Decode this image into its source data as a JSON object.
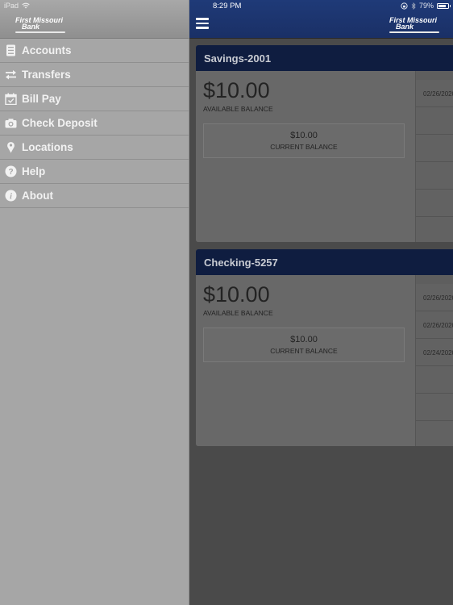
{
  "status_bar": {
    "device": "iPad",
    "time": "8:29 PM",
    "battery": "79%",
    "battery_level": 0.79
  },
  "brand": {
    "line1": "First Missouri",
    "line2": "Bank"
  },
  "sidebar": {
    "items": [
      {
        "label": "Accounts",
        "icon": "accounts-icon"
      },
      {
        "label": "Transfers",
        "icon": "transfers-icon"
      },
      {
        "label": "Bill Pay",
        "icon": "calendar-check-icon"
      },
      {
        "label": "Check Deposit",
        "icon": "camera-icon"
      },
      {
        "label": "Locations",
        "icon": "map-pin-icon"
      },
      {
        "label": "Help",
        "icon": "help-icon"
      },
      {
        "label": "About",
        "icon": "info-icon"
      }
    ]
  },
  "accounts": [
    {
      "name": "Savings-2001",
      "available_balance": "$10.00",
      "available_label": "AVAILABLE BALANCE",
      "current_balance": "$10.00",
      "current_label": "CURRENT BALANCE",
      "transactions": [
        "02/26/2020",
        "",
        "",
        "",
        "",
        ""
      ]
    },
    {
      "name": "Checking-5257",
      "available_balance": "$10.00",
      "available_label": "AVAILABLE BALANCE",
      "current_balance": "$10.00",
      "current_label": "CURRENT BALANCE",
      "transactions": [
        "02/26/2020",
        "02/26/2020",
        "02/24/2020",
        "",
        "",
        ""
      ]
    }
  ]
}
